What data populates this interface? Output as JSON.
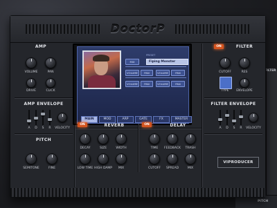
{
  "app": {
    "logo": "DoctorP"
  },
  "amp": {
    "title": "AMP",
    "knobs": [
      "VOLUME",
      "PAN",
      "DRIVE",
      "CLICK"
    ],
    "envelope_title": "AMP ENVELOPE",
    "env_labels": [
      "A",
      "D",
      "S",
      "R",
      "VELOCITY"
    ]
  },
  "pitch": {
    "title": "PITCH",
    "knobs": [
      "SEMITONE",
      "FINE"
    ]
  },
  "filter": {
    "on_label": "ON",
    "title": "FILTER",
    "knobs": [
      "CUTOFF",
      "RES",
      "ENVELOPE"
    ],
    "type_label": "TYPE",
    "envelope_title": "FILTER ENVELOPE",
    "env_labels": [
      "A",
      "D",
      "S",
      "R",
      "VELOCITY"
    ]
  },
  "screen": {
    "preset_label": "PRESET",
    "preset_value": "Fiping Monster",
    "mix_label": "MIX",
    "row_buttons": [
      "VOLUME",
      "PAN",
      "VOLUME",
      "PAN"
    ],
    "row2_buttons": [
      "VOLUME",
      "PAN",
      "VOLUME",
      "PAN"
    ],
    "tabs": [
      "MAIN",
      "MOD",
      "ARP",
      "GATE",
      "FX",
      "MASTER"
    ],
    "active_tab": "MAIN"
  },
  "reverb": {
    "on_label": "ON",
    "title": "REVERB",
    "knobs": [
      "DECAY",
      "SIZE",
      "WIDTH",
      "LOW TIME",
      "HIGH DAMP",
      "MIX"
    ]
  },
  "delay": {
    "on_label": "ON",
    "title": "DELAY",
    "knobs": [
      "TIME",
      "FEEDBACK",
      "TRASH",
      "CUTOFF",
      "SPREAD",
      "MIX"
    ]
  },
  "brand": "VIPRODUCER",
  "background": {
    "ghost_labels": [
      "PITCH",
      "FILTER"
    ]
  },
  "colors": {
    "accent_on": "#d4541f",
    "screen_blue": "#2e3c6a"
  }
}
